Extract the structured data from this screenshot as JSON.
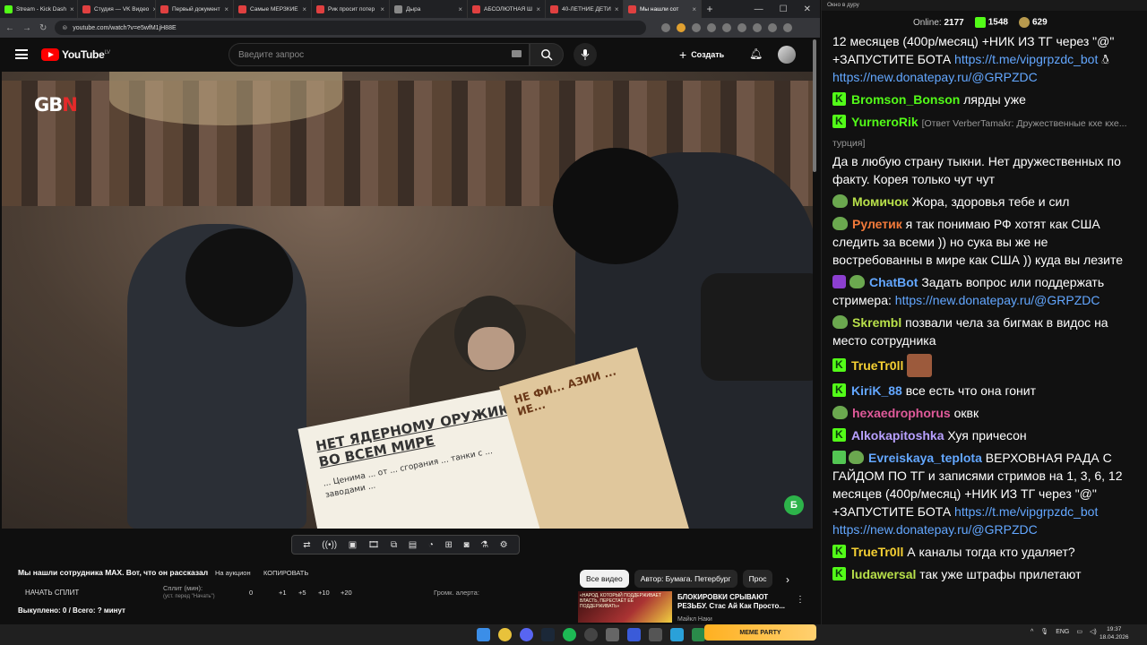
{
  "browser": {
    "tabs": [
      {
        "label": "Stream - Kick Dash",
        "color": "#53fc18"
      },
      {
        "label": "Студия — VK Видео",
        "color": "#e04040"
      },
      {
        "label": "Первый документ",
        "color": "#e04040"
      },
      {
        "label": "Самые МЕРЗКИЕ",
        "color": "#e04040"
      },
      {
        "label": "Рик просит потер",
        "color": "#e04040"
      },
      {
        "label": "Дыра",
        "color": "#888888"
      },
      {
        "label": "АБСОЛЮТНАЯ Ш",
        "color": "#e04040"
      },
      {
        "label": "40-ЛЕТНИЕ ДЕТИ",
        "color": "#e04040"
      },
      {
        "label": "Мы нашли сот",
        "color": "#e04040"
      }
    ],
    "url": "youtube.com/watch?v=e5wfM1jH88E"
  },
  "youtube": {
    "logo_text": "YouTube",
    "region": "LV",
    "search_placeholder": "Введите запрос",
    "create_label": "Создать"
  },
  "video": {
    "watermark": "GB",
    "watermark_accent": "N",
    "sign1_title": "НЕТ ЯДЕРНОМУ ОРУЖИЮ ВО ВСЕМ МИРЕ",
    "sign1_body": "... Ценима ... от ... сгорания ... танки с ... заводами ...",
    "sign2_text": "НЕ ФИ... АЗИИ ... ИЕ...",
    "corner_badge": "Б"
  },
  "below": {
    "title": "Мы нашли сотрудника МАХ. Вот, что он рассказал",
    "auction": "На аукцион",
    "copy": "КОПИРОВАТЬ",
    "start_split": "НАЧАТЬ СПЛИТ",
    "split_label": "Сплит (мин):",
    "split_hint": "(уст. перед \"Начать\")",
    "split_values": [
      "0",
      "+1",
      "+5",
      "+10",
      "+20"
    ],
    "alert_label": "Громк. алерта:",
    "bought": "Выкуплено: 0 / Всего: ? минут"
  },
  "chips": [
    "Все видео",
    "Автор: Бумага. Петербург",
    "Прос"
  ],
  "recommended": {
    "thumb_caption": "«НАРОД, КОТОРЫЙ ПОДДЕРЖИВАЕТ ВЛАСТЬ, ПЕРЕСТАЁТ ЕЁ ПОДДЕРЖИВАТЬ»",
    "title": "БЛОКИРОВКИ СРЫВАЮТ РЕЗЬБУ. Стас Ай Как Просто...",
    "channel": "Майкл Наки"
  },
  "chat": {
    "window_title": "Окно в дуру",
    "online_label": "Online:",
    "online": "2177",
    "kick_count": "1548",
    "pepe_count": "629",
    "messages": [
      {
        "nick": "",
        "color": "#ffffff",
        "text": "12 месяцев (400р/месяц) +НИК ИЗ ТГ через \"@\" +ЗАПУСТИТЕ БОТА ",
        "link": "https://t.me/vipgrpzdc_bot",
        "link2": "https://new.donatepay.ru/@GRPZDC"
      },
      {
        "nick": "Bromson_Bonson",
        "color": "#53fc18",
        "text": "лярды уже"
      },
      {
        "nick": "YurneroRik",
        "color": "#53fc18",
        "reply": "[Ответ VerberTamakr: Дружественные кхе кхе... турция]",
        "text": "Да в любую страну тыкни. Нет дружественных по факту. Корея только чут чут"
      },
      {
        "nick": "Момичок",
        "color": "#b8e04a",
        "text": "Жора, здоровья тебе и сил"
      },
      {
        "nick": "Рулетик",
        "color": "#f27a3a",
        "text": "я так понимаю РФ хотят как США следить за всеми )) но сука вы же не востребованны в мире как США )) куда вы лезите"
      },
      {
        "nick": "ChatBot",
        "color": "#63a7ff",
        "text": "Задать вопрос или поддержать стримера: ",
        "link": "https://new.donatepay.ru/@GRPZDC"
      },
      {
        "nick": "Skrembl",
        "color": "#b8e04a",
        "text": "позвали чела за бигмак в видос на место сотрудника"
      },
      {
        "nick": "TrueTr0ll",
        "color": "#f5d033",
        "text": ""
      },
      {
        "nick": "KiriK_88",
        "color": "#63a7ff",
        "text": "все есть что она гонит"
      },
      {
        "nick": "hexaedrophorus",
        "color": "#e05a9a",
        "text": "оквк"
      },
      {
        "nick": "Alkokapitoshka",
        "color": "#b8a0ff",
        "text": "Хуя причесон"
      },
      {
        "nick": "Evreiskaya_teplota",
        "color": "#63a7ff",
        "text": "ВЕРХОВНАЯ РАДА С ГАЙДОМ ПО ТГ и записями стримов",
        "text2": " на 1, 3, 6, 12 месяцев (400р/месяц) +НИК ИЗ ТГ через \"@\" +ЗАПУСТИТЕ БОТА ",
        "link": "https://t.me/vipgrpzdc_bot",
        "link2": "https://new.donatepay.ru/@GRPZDC"
      },
      {
        "nick": "TrueTr0ll",
        "color": "#f5d033",
        "text": "А каналы тогда кто удаляет?"
      },
      {
        "nick": "ludawersal",
        "color": "#b8e04a",
        "text": "так уже штрафы прилетают"
      }
    ]
  },
  "taskbar": {
    "meme_label": "MEME PARTY",
    "lang": "ENG",
    "time": "19:37",
    "date": "18.04.2026"
  }
}
